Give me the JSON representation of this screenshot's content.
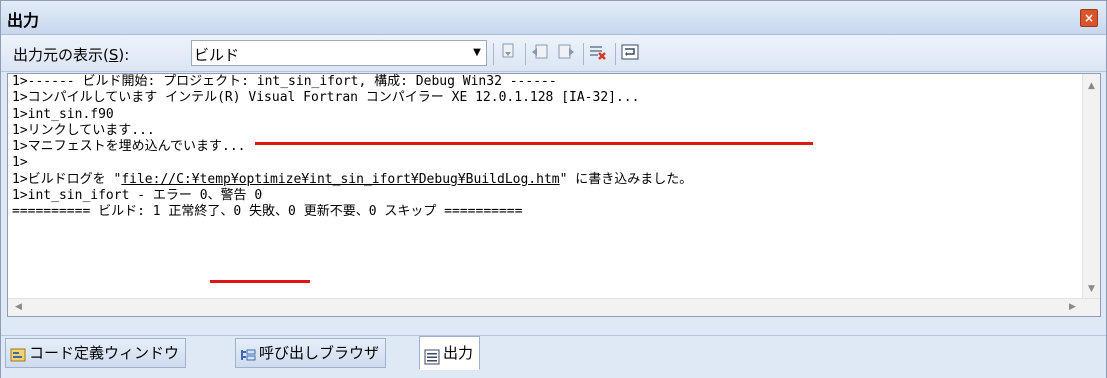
{
  "window": {
    "title": "出力",
    "close_glyph": "×"
  },
  "toolbar": {
    "source_label_pre": "出力元の表示(",
    "source_label_key": "S",
    "source_label_post": "):",
    "source_value": "ビルド",
    "dropdown_arrow": "▼"
  },
  "output": {
    "lines": [
      "1>------ ビルド開始: プロジェクト: int_sin_ifort, 構成: Debug Win32 ------",
      "1>コンパイルしています インテル(R) Visual Fortran コンパイラー XE 12.0.1.128 [IA-32]...",
      "1>int_sin.f90",
      "1>リンクしています...",
      "1>マニフェストを埋め込んでいます...",
      "1>",
      "1>ビルドログを \"",
      "1>int_sin_ifort - エラー 0、警告 0",
      "========== ビルド: 1 正常終了、0 失敗、0 更新不要、0 スキップ =========="
    ],
    "log_link": "file://C:¥temp¥optimize¥int_sin_ifort¥Debug¥BuildLog.htm",
    "log_suffix": "\" に書き込みました。"
  },
  "tabs": [
    {
      "label": "コード定義ウィンドウ",
      "icon": "code-definition-icon"
    },
    {
      "label": "呼び出しブラウザ",
      "icon": "call-browser-icon"
    },
    {
      "label": "出力",
      "icon": "output-icon",
      "active": true
    }
  ],
  "colors": {
    "highlight_underline": "#e01616",
    "frame_bg": "#dfe8f5"
  }
}
